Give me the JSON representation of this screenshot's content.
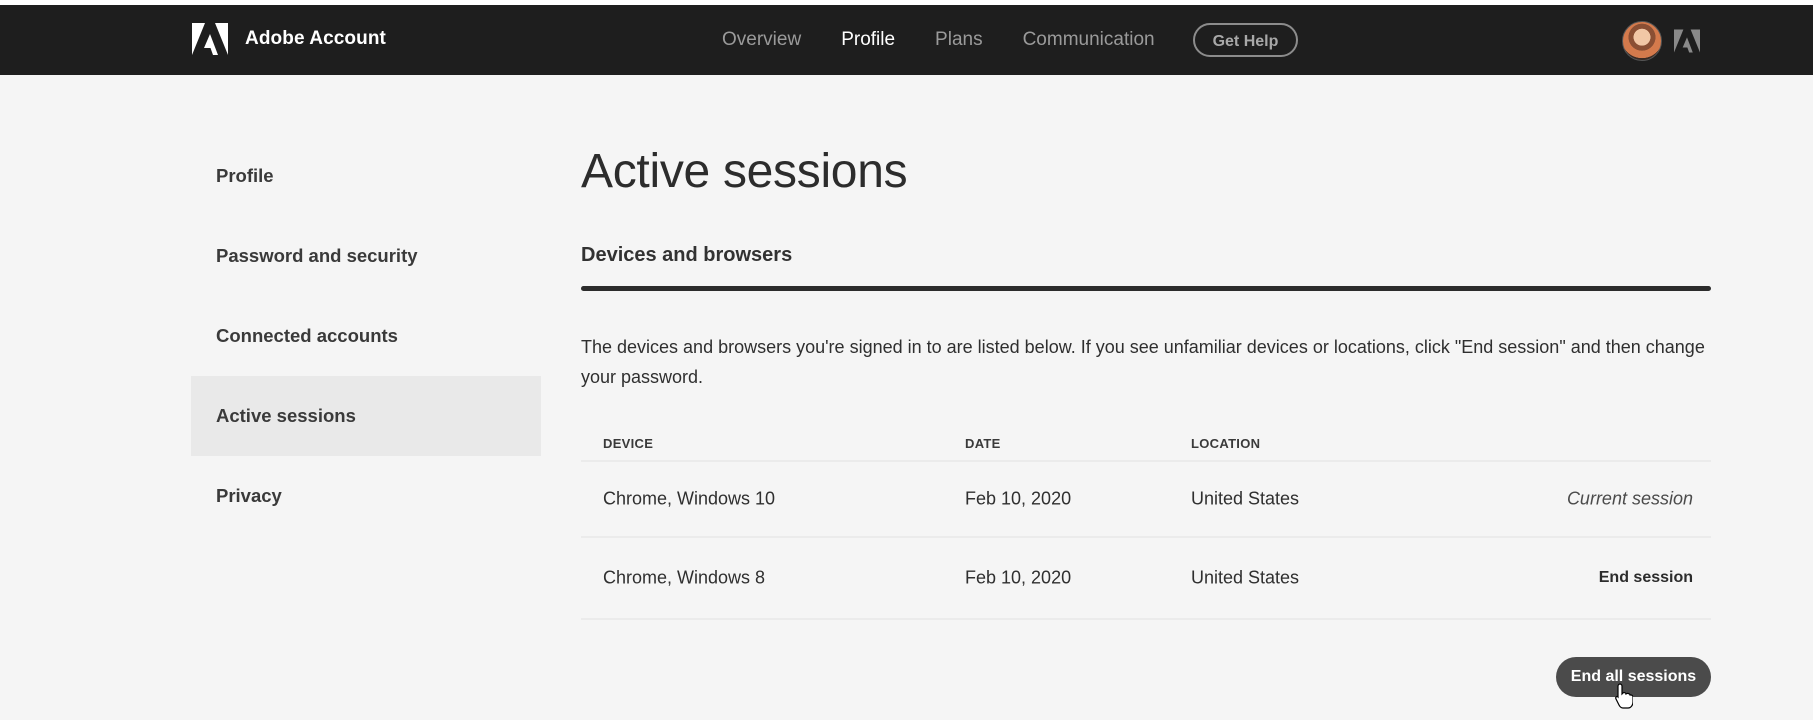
{
  "header": {
    "app_name": "Adobe Account",
    "nav": [
      {
        "label": "Overview",
        "active": false
      },
      {
        "label": "Profile",
        "active": true
      },
      {
        "label": "Plans",
        "active": false
      },
      {
        "label": "Communication",
        "active": false
      }
    ],
    "help_label": "Get Help",
    "avatar_icon": "user-avatar",
    "brand_icon": "adobe-logo-icon"
  },
  "sidebar": {
    "items": [
      {
        "label": "Profile",
        "active": false
      },
      {
        "label": "Password and security",
        "active": false
      },
      {
        "label": "Connected accounts",
        "active": false
      },
      {
        "label": "Active sessions",
        "active": true
      },
      {
        "label": "Privacy",
        "active": false
      }
    ]
  },
  "main": {
    "title": "Active sessions",
    "section_title": "Devices and browsers",
    "description": "The devices and browsers you're signed in to are listed below. If you see unfamiliar devices or locations, click \"End session\" and then change your password.",
    "table": {
      "headers": {
        "device": "DEVICE",
        "date": "DATE",
        "location": "LOCATION"
      },
      "rows": [
        {
          "device": "Chrome, Windows 10",
          "date": "Feb 10, 2020",
          "location": "United States",
          "action": "Current session"
        },
        {
          "device": "Chrome, Windows 8",
          "date": "Feb 10, 2020",
          "location": "United States",
          "action": "End session"
        }
      ]
    },
    "end_all_label": "End all sessions"
  },
  "colors": {
    "header_bg": "#1e1e1e",
    "page_bg": "#f5f5f5",
    "active_sidebar_bg": "#e9e9e9",
    "button_bg": "#4b4b4b"
  }
}
